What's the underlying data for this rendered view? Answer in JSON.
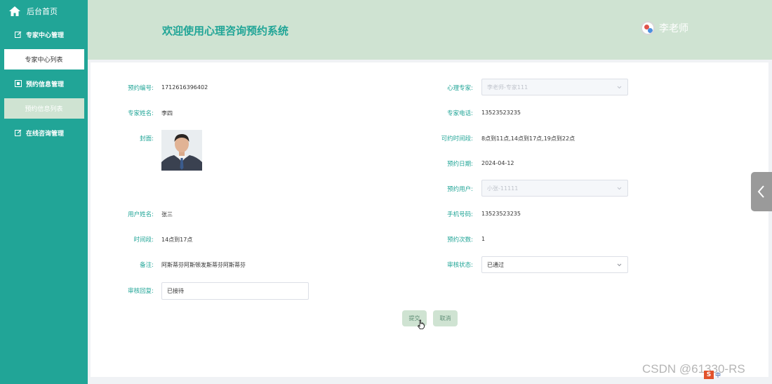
{
  "sidebar": {
    "home_label": "后台首页",
    "groups": [
      {
        "label": "专家中心管理",
        "sub": "专家中心列表"
      },
      {
        "label": "预约信息管理",
        "sub": "预约信息列表"
      },
      {
        "label": "在线咨询管理"
      }
    ]
  },
  "header": {
    "title": "欢迎使用心理咨询预约系统",
    "user_name": "李老师"
  },
  "form": {
    "booking_no_label": "预约编号:",
    "booking_no": "1712616396402",
    "expert_label": "心理专家:",
    "expert_value": "李老师-专家111",
    "expert_name_label": "专家姓名:",
    "expert_name": "李四",
    "expert_phone_label": "专家电话:",
    "expert_phone": "13523523235",
    "cover_label": "封面:",
    "available_label": "可约时间段:",
    "available_value": "8点到11点,14点到17点,19点到22点",
    "date_label": "预约日期:",
    "date_value": "2024-04-12",
    "user_label": "预约用户:",
    "user_value": "小张-11111",
    "username_label": "用户姓名:",
    "username_value": "张三",
    "mobile_label": "手机号码:",
    "mobile_value": "13523523235",
    "period_label": "时间段:",
    "period_value": "14点到17点",
    "count_label": "预约次数:",
    "count_value": "1",
    "remark_label": "备注:",
    "remark_value": "阿斯蒂芬阿斯顿发斯蒂芬阿斯蒂芬",
    "status_label": "审核状态:",
    "status_value": "已通过",
    "reply_label": "审核回复:",
    "reply_value": "已接待",
    "submit_label": "提交",
    "cancel_label": "取消"
  },
  "watermark": "CSDN @61330-RS",
  "ime_label": "中"
}
